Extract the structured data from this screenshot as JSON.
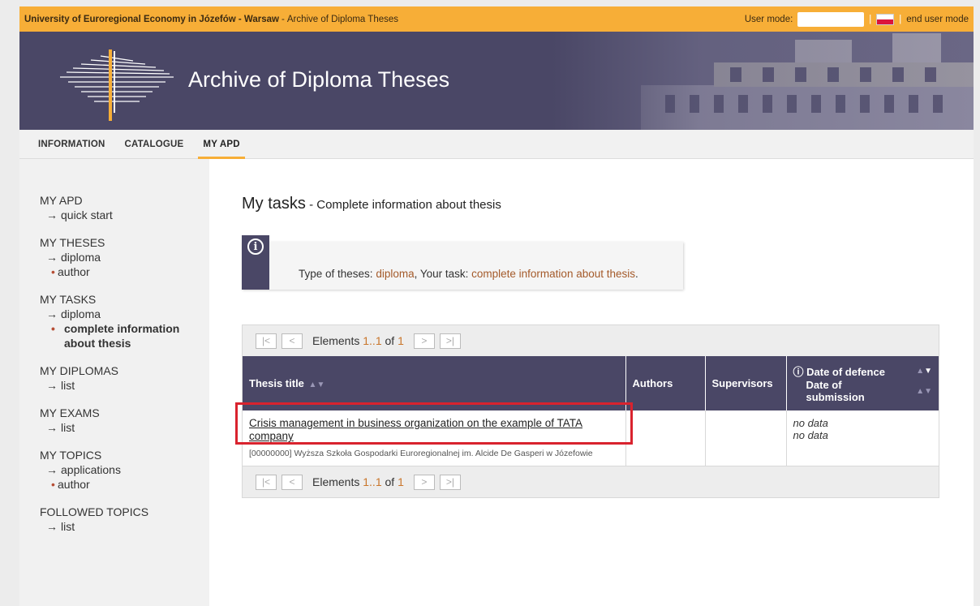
{
  "topbar": {
    "university": "University of Euroregional Economy in Józefów - Warsaw",
    "separator": " - ",
    "section": "Archive of Diploma Theses",
    "user_mode_label": "User mode:",
    "user_mode_value": "",
    "end_user_mode": "end user mode"
  },
  "banner": {
    "title": "Archive of Diploma Theses"
  },
  "nav": [
    {
      "label": "INFORMATION"
    },
    {
      "label": "CATALOGUE"
    },
    {
      "label": "MY APD"
    }
  ],
  "sidebar": {
    "groups": [
      {
        "head": "MY APD",
        "subs": [
          {
            "label": "quick start"
          }
        ]
      },
      {
        "head": "MY THESES",
        "subs": [
          {
            "label": "diploma",
            "leaves": [
              "author"
            ]
          }
        ]
      },
      {
        "head": "MY TASKS",
        "subs": [
          {
            "label": "diploma",
            "leaves": [
              "complete information about thesis"
            ]
          }
        ]
      },
      {
        "head": "MY DIPLOMAS",
        "subs": [
          {
            "label": "list"
          }
        ]
      },
      {
        "head": "MY EXAMS",
        "subs": [
          {
            "label": "list"
          }
        ]
      },
      {
        "head": "MY TOPICS",
        "subs": [
          {
            "label": "applications",
            "leaves": [
              "author"
            ]
          }
        ]
      },
      {
        "head": "FOLLOWED TOPICS",
        "subs": [
          {
            "label": "list"
          }
        ]
      }
    ]
  },
  "main": {
    "title": "My tasks",
    "subtitle": " - Complete information about thesis",
    "info": {
      "prefix": "Type of theses: ",
      "type": "diploma",
      "middle": ", Your task: ",
      "task": "complete information about thesis",
      "suffix": "."
    },
    "pager": {
      "label": "Elements",
      "range": "1..1",
      "of": "of",
      "total": "1",
      "first": "|<",
      "prev": "<",
      "next": ">",
      "last": ">|"
    },
    "table": {
      "headers": {
        "title": "Thesis title",
        "authors": "Authors",
        "supervisors": "Supervisors",
        "defence": "Date of defence",
        "submission": "Date of submission"
      },
      "rows": [
        {
          "title": "Crisis management in business organization on the example of TATA company",
          "institution": "[00000000] Wyższa Szkoła Gospodarki Euroregionalnej im. Alcide De Gasperi w Józefowie",
          "authors": "",
          "supervisors": "",
          "defence": "no data",
          "submission": "no data"
        }
      ]
    }
  },
  "colors": {
    "accent_orange": "#f7ae37",
    "header_purple": "#4a4766",
    "highlight_red": "#d9232e"
  }
}
